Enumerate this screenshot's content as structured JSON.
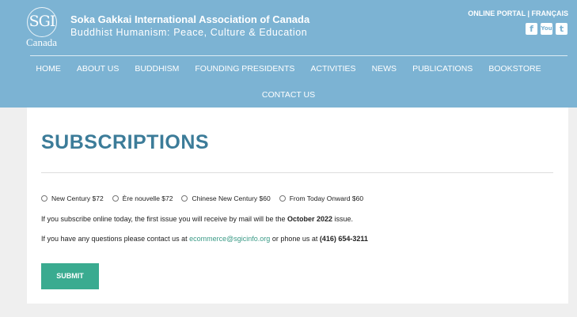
{
  "header": {
    "logo_mark": "SGI",
    "logo_text": "Canada",
    "org_name": "Soka Gakkai International Association of Canada",
    "tagline": "Buddhist Humanism: Peace, Culture & Education",
    "top_links": {
      "portal": "ONLINE PORTAL",
      "separator": "|",
      "french": "FRANÇAIS"
    },
    "socials": [
      {
        "icon": "facebook-icon",
        "glyph": "f"
      },
      {
        "icon": "youtube-icon",
        "glyph": "You"
      },
      {
        "icon": "tumblr-icon",
        "glyph": "t"
      }
    ]
  },
  "nav": {
    "items": [
      "HOME",
      "ABOUT US",
      "BUDDHISM",
      "FOUNDING PRESIDENTS",
      "ACTIVITIES",
      "NEWS",
      "PUBLICATIONS",
      "BOOKSTORE",
      "CONTACT US"
    ]
  },
  "main": {
    "title": "SUBSCRIPTIONS",
    "options": [
      "New Century $72",
      "Ère nouvelle $72",
      "Chinese New Century $60",
      "From Today Onward $60"
    ],
    "para1": {
      "before": "If you subscribe online today, the first issue you will receive by mail will be the ",
      "bold": "October 2022",
      "after": " issue."
    },
    "para2": {
      "before": "If you have any questions please contact us at ",
      "email": "ecommerce@sgicinfo.org",
      "middle": " or phone us at ",
      "phone": "(416) 654-3211"
    },
    "submit_label": "SUBMIT"
  },
  "colors": {
    "header_bg": "#7cb3d3",
    "title": "#3c7c99",
    "submit_bg": "#3aab90",
    "link": "#3a9a86"
  }
}
